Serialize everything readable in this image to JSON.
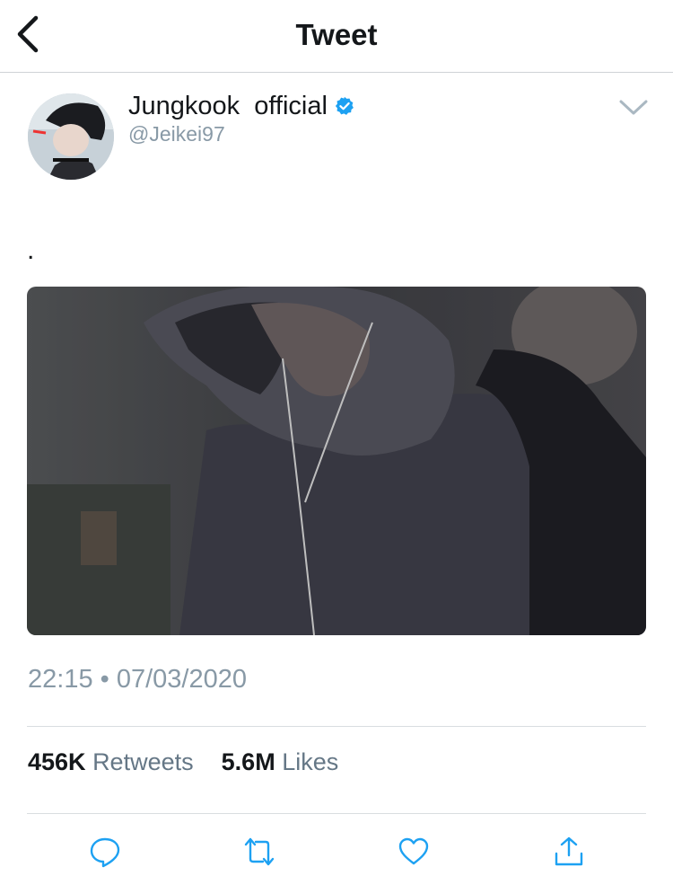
{
  "header": {
    "title": "Tweet",
    "back_icon": "chevron-left-icon"
  },
  "author": {
    "name": "Jungkook  official",
    "handle": "@Jeikei97",
    "verified": true,
    "verified_icon": "verified-badge-icon",
    "menu_icon": "chevron-down-icon"
  },
  "tweet": {
    "text": ".",
    "timestamp": "22:15 • 07/03/2020"
  },
  "stats": {
    "retweets_count": "456K",
    "retweets_label": "Retweets",
    "likes_count": "5.6M",
    "likes_label": "Likes"
  },
  "actions": [
    "reply-icon",
    "retweet-icon",
    "like-icon",
    "share-icon"
  ],
  "colors": {
    "verified": "#1da1f2",
    "secondary_text": "#8899a6",
    "icon": "#1da1f2"
  }
}
